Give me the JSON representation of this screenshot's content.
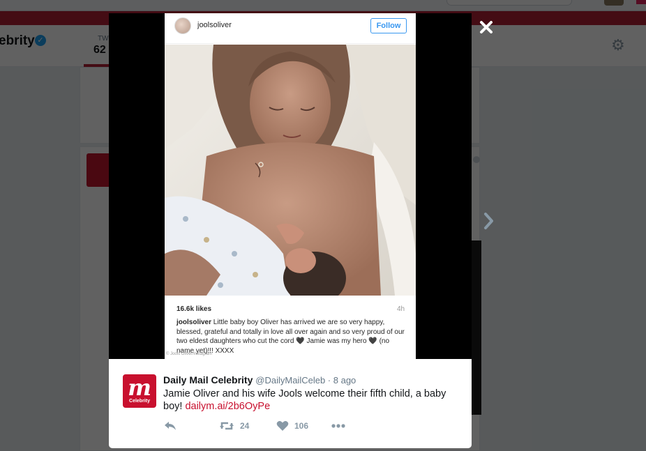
{
  "background": {
    "profile_name": "ebrity",
    "tweets_label": "TW",
    "tweets_count": "62"
  },
  "instagram": {
    "username": "joolsoliver",
    "follow_label": "Follow",
    "likes": "16.6k likes",
    "time": "4h",
    "caption_user": "joolsoliver",
    "caption_text": "Little baby boy Oliver has arrived we are so very happy, blessed, grateful and totally in love all over again and so very proud of our two eldest daughters who cut the cord 🖤 Jamie was my hero 🖤 (no name yet)!!! XXXX",
    "watermark": "© Jools Oliver/Instagram"
  },
  "tweet": {
    "avatar_letter": "m",
    "avatar_label": "Celebrity",
    "name": "Daily Mail Celebrity",
    "handle": "@DailyMailCeleb",
    "separator": " · ",
    "time": "8 ago",
    "text": "Jamie Oliver and his wife Jools welcome their fifth child, a baby boy! ",
    "link": "dailym.ai/2b6OyPe",
    "retweets": "24",
    "likes": "106"
  },
  "icons": {
    "close": "close-icon",
    "next": "chevron-right-icon",
    "reply": "reply-icon",
    "retweet": "retweet-icon",
    "like": "heart-icon",
    "more": "more-icon",
    "settings": "gear-icon",
    "verified": "verified-icon"
  },
  "colors": {
    "brand_red": "#c8102e",
    "instagram_blue": "#3897f0",
    "twitter_blue": "#1da1f2"
  }
}
